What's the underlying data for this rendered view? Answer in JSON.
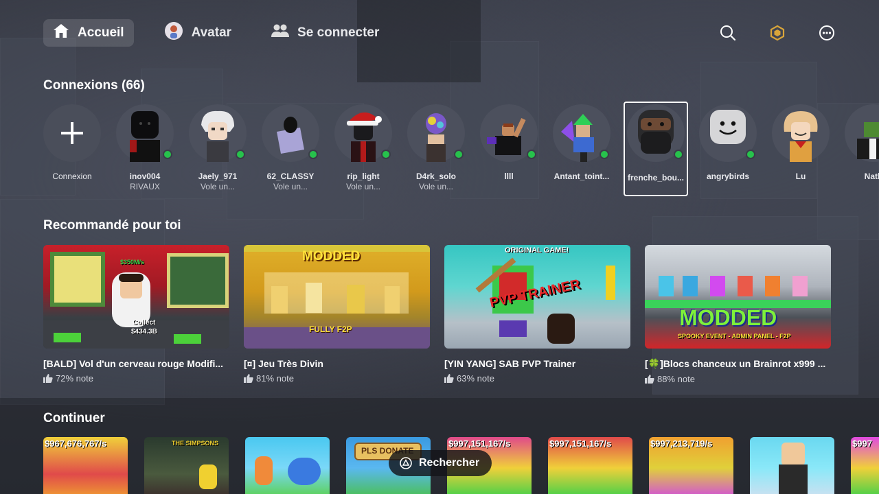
{
  "nav": {
    "home_label": "Accueil",
    "avatar_label": "Avatar",
    "connect_label": "Se connecter"
  },
  "connections": {
    "title": "Connexions (66)",
    "add_label": "Connexion",
    "items": [
      {
        "name": "inov004",
        "status": "RIVAUX"
      },
      {
        "name": "Jaely_971",
        "status": "Vole un..."
      },
      {
        "name": "62_CLASSY",
        "status": "Vole un..."
      },
      {
        "name": "rip_light",
        "status": "Vole un..."
      },
      {
        "name": "D4rk_solo",
        "status": "Vole un..."
      },
      {
        "name": "llll",
        "status": ""
      },
      {
        "name": "Antant_toint...",
        "status": ""
      },
      {
        "name": "frenche_bou...",
        "status": ""
      },
      {
        "name": "angrybirds",
        "status": ""
      },
      {
        "name": "Lu",
        "status": ""
      },
      {
        "name": "Nath",
        "status": ""
      }
    ]
  },
  "recommended": {
    "title": "Recommandé pour toi",
    "games": [
      {
        "title": "[BALD] Vol d'un cerveau rouge Modifi...",
        "rating": "72% note",
        "thumb_texts": [
          "$350M/s",
          "Collect",
          "$434.3B"
        ]
      },
      {
        "title": "[¤] Jeu Très Divin",
        "rating": "81% note",
        "thumb_texts": [
          "MODDED",
          "FULLY F2P"
        ]
      },
      {
        "title": "[YIN YANG] SAB PVP Trainer",
        "rating": "63% note",
        "thumb_texts": [
          "ORIGINAL GAME!",
          "PVP TRAINER"
        ]
      },
      {
        "title": "[🍀]Blocs chanceux un Brainrot x999 ...",
        "rating": "88% note",
        "thumb_texts": [
          "MODDED",
          "SPOOKY EVENT - ADMIN PANEL - F2P"
        ]
      }
    ]
  },
  "continue": {
    "title": "Continuer",
    "items": [
      {
        "label": "$967,676,767/s"
      },
      {
        "label": "THE SIMPSONS"
      },
      {
        "label": ""
      },
      {
        "label": "PLS DONATE"
      },
      {
        "label": "$997,151,167/s"
      },
      {
        "label": "$997,151,167/s"
      },
      {
        "label": "$997,213,719/s"
      },
      {
        "label": ""
      },
      {
        "label": "$997"
      }
    ]
  },
  "search_pill": {
    "label": "Rechercher"
  },
  "colors": {
    "online": "#27c24c",
    "robux_gold": "#d9a53a",
    "thumb_up": "#d4d6dc"
  }
}
